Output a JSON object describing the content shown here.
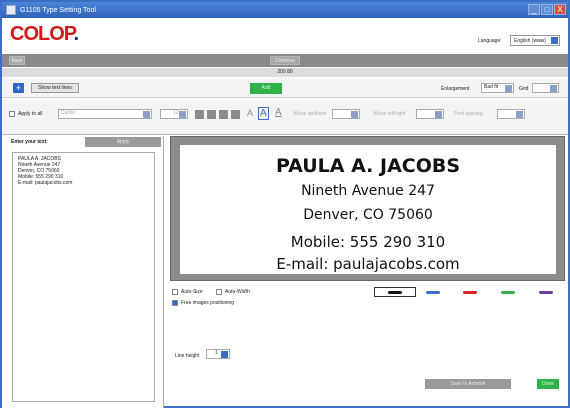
{
  "window": {
    "title": "G1105 Type Setting Tool",
    "min": "_",
    "max": "□",
    "close": "X"
  },
  "logo": {
    "main": "COLOP",
    "suffix": "."
  },
  "language": {
    "label": "Language:",
    "value": "English (www)"
  },
  "nav": {
    "back": "Back",
    "next": "Continue"
  },
  "size_label": "200 80",
  "toolbar": {
    "plus": "+",
    "show_text_lines": "Show text lines",
    "add": "Add",
    "enlargement_label": "Enlargement",
    "enlargement_value": "Bad fit",
    "grid_label": "Grid",
    "grid_value": ""
  },
  "format": {
    "apply_to_all": "Apply to all",
    "font_value": "Calibri",
    "size_value": "12",
    "letters": [
      "A",
      "A",
      "A"
    ],
    "move_up_down": "Move up/down",
    "move_left_right": "Move left/right",
    "font_spacing": "Font spacing"
  },
  "editor": {
    "enter_label": "Enter your text:",
    "apply": "Apply",
    "lines": [
      "PAULA A. JACOBS",
      "Nineth Avenue 247",
      "Denver, CO 75060",
      "Mobile: 555 290 310",
      "E-mail: paulajacobs.com"
    ]
  },
  "stamp": {
    "lines": [
      "PAULA A. JACOBS",
      "Nineth Avenue 247",
      "Denver, CO 75060",
      "Mobile: 555 290 310",
      "E-mail: paulajacobs.com"
    ]
  },
  "options": {
    "auto_size": "Auto-Size",
    "auto_width": "Auto-Width",
    "free_positioning": "Free images positioning",
    "line_height_label": "Line height",
    "line_height_value": "1",
    "pen_colors": [
      "#111111",
      "#3a6fd0",
      "#d6262a",
      "#2fae4a",
      "#6b3aa8"
    ]
  },
  "footer": {
    "save": "Save to Artwork",
    "done": "Done"
  }
}
